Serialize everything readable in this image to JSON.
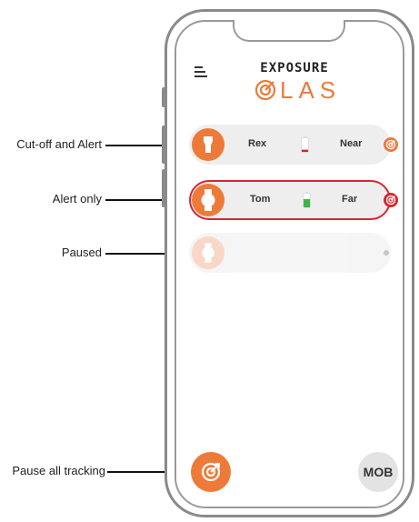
{
  "annotations": {
    "cutoff_alert": "Cut-off and Alert",
    "alert_only": "Alert only",
    "paused": "Paused",
    "pause_all": "Pause all tracking"
  },
  "header": {
    "brand_top": "EXPOSURE",
    "brand_bottom": "LAS",
    "menu_icon": "hamburger-icon"
  },
  "devices": [
    {
      "name": "Rex",
      "range": "Near",
      "battery_level": 0.15,
      "battery_color": "#d62630",
      "mode": "cut-off-and-alert",
      "status_color": "#ee7a3a",
      "icon": "lamp-icon"
    },
    {
      "name": "Tom",
      "range": "Far",
      "battery_level": 0.55,
      "battery_color": "#3bb54a",
      "mode": "alert-only",
      "status_color": "#d62630",
      "icon": "watch-icon"
    },
    {
      "name": "",
      "range": "",
      "mode": "paused",
      "icon": "watch-icon"
    }
  ],
  "bottom": {
    "mob_label": "MOB",
    "pause_icon": "target-icon"
  },
  "colors": {
    "accent": "#ee7a3a",
    "alert": "#d62630",
    "row_bg": "#eeeeee"
  }
}
